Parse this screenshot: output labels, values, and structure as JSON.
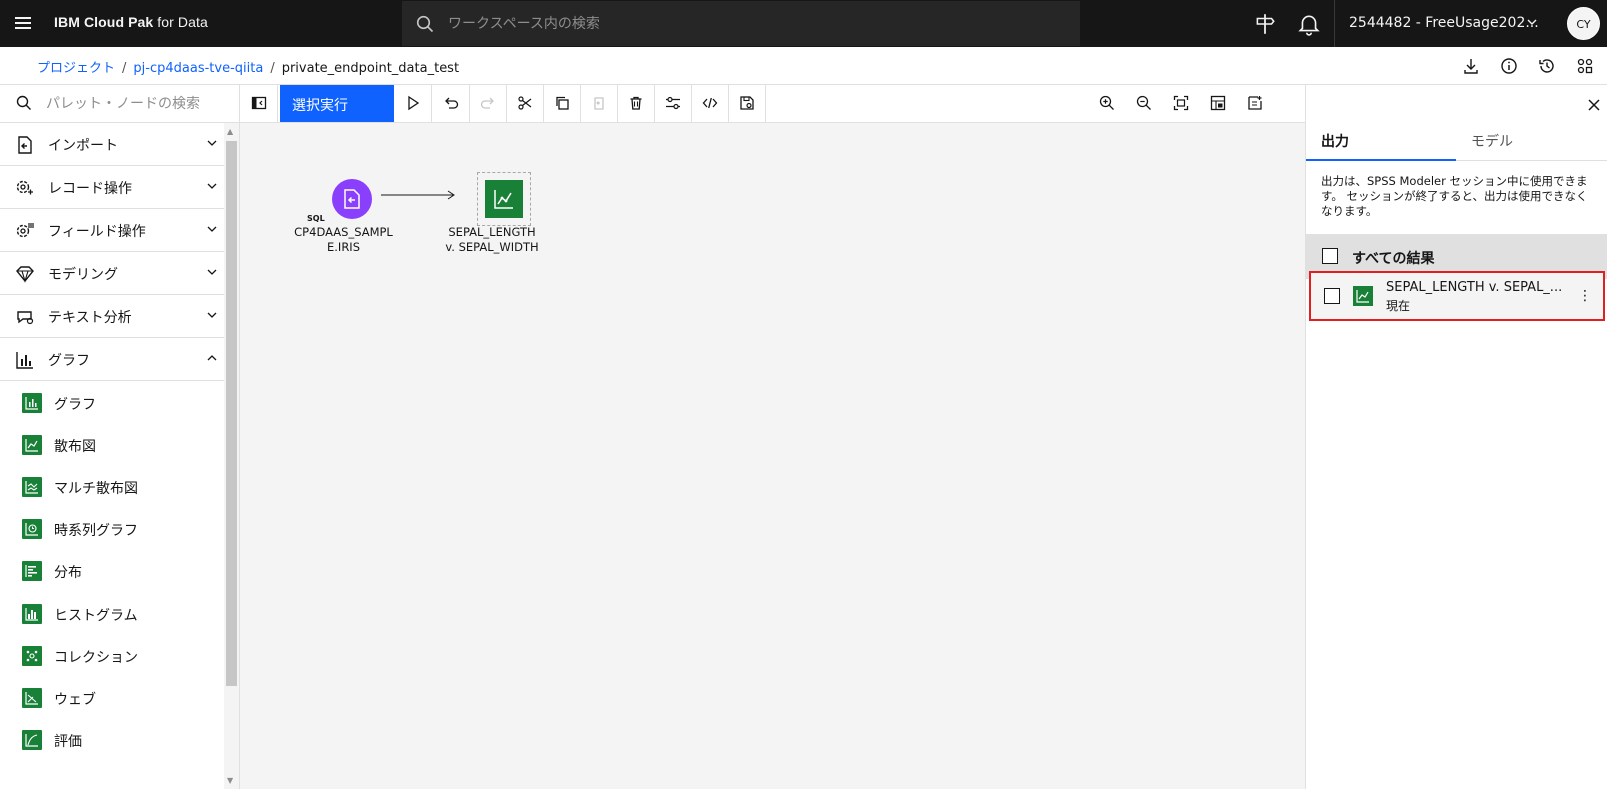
{
  "header": {
    "brand_bold": "IBM Cloud Pak",
    "brand_rest": " for Data",
    "search_placeholder": "ワークスペース内の検索",
    "account": "2544482 - FreeUsage202...",
    "avatar": "CY"
  },
  "breadcrumb": {
    "items": [
      "プロジェクト",
      "pj-cp4daas-tve-qiita"
    ],
    "separator": "/",
    "current": "private_endpoint_data_test"
  },
  "palette": {
    "search_placeholder": "パレット・ノードの検索",
    "categories": [
      {
        "label": "インポート"
      },
      {
        "label": "レコード操作"
      },
      {
        "label": "フィールド操作"
      },
      {
        "label": "モデリング"
      },
      {
        "label": "テキスト分析"
      },
      {
        "label": "グラフ"
      }
    ],
    "graph_nodes": [
      {
        "label": "グラフ"
      },
      {
        "label": "散布図"
      },
      {
        "label": "マルチ散布図"
      },
      {
        "label": "時系列グラフ"
      },
      {
        "label": "分布"
      },
      {
        "label": "ヒストグラム"
      },
      {
        "label": "コレクション"
      },
      {
        "label": "ウェブ"
      },
      {
        "label": "評価"
      }
    ]
  },
  "toolbar": {
    "run_label": "選択実行"
  },
  "canvas": {
    "source_node": {
      "badge": "SQL",
      "label_line1": "CP4DAAS_SAMPL",
      "label_line2": "E.IRIS"
    },
    "plot_node": {
      "label_line1": "SEPAL_LENGTH",
      "label_line2": "v. SEPAL_WIDTH"
    }
  },
  "right_panel": {
    "tabs": [
      "出力",
      "モデル"
    ],
    "active_tab": "出力",
    "description": "出力は、SPSS Modeler セッション中に使用できます。 セッションが終了すると、出力は使用できなくなります。",
    "all_results": "すべての結果",
    "results": [
      {
        "title": "SEPAL_LENGTH v. SEPAL_...",
        "status": "現在"
      }
    ],
    "highlight_color": "#e02020"
  },
  "colors": {
    "accent": "#0f62fe",
    "header_bg": "#161616",
    "graph_node": "#198038",
    "source_node": "#8a3ffc"
  }
}
